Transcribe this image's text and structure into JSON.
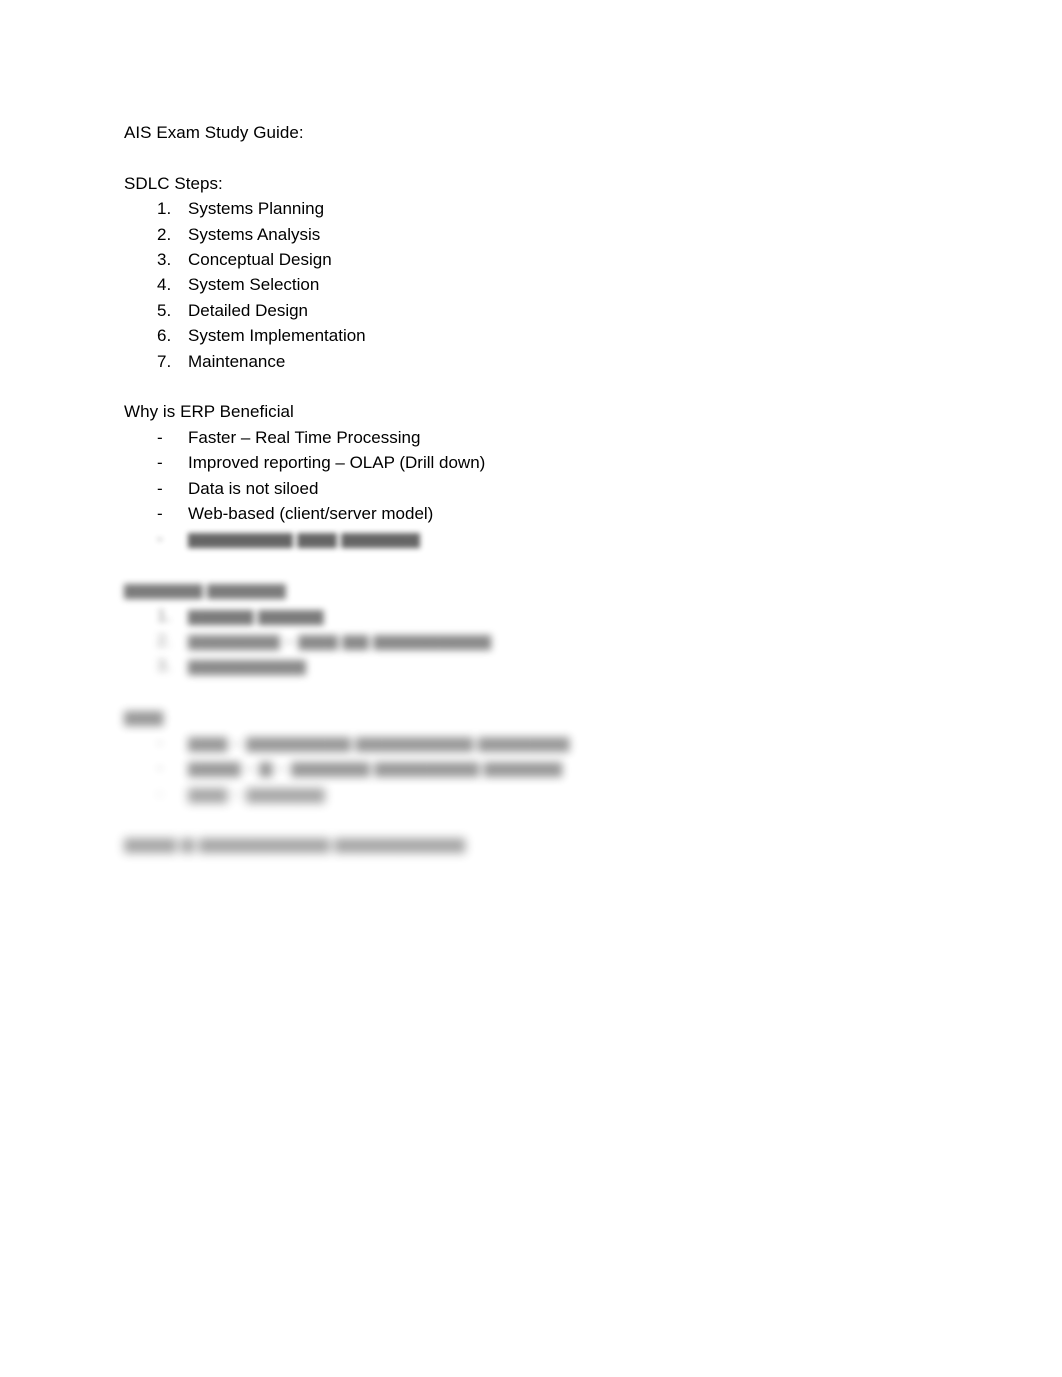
{
  "document": {
    "title": "AIS Exam Study Guide:",
    "page_background": "#ffffff",
    "text_color": "#000000",
    "sections": {
      "sdlc": {
        "heading": "SDLC Steps:",
        "list_type": "numbered",
        "items": [
          {
            "marker": "1.",
            "text": "Systems Planning"
          },
          {
            "marker": "2.",
            "text": "Systems Analysis"
          },
          {
            "marker": "3.",
            "text": "Conceptual Design"
          },
          {
            "marker": "4.",
            "text": "System Selection"
          },
          {
            "marker": "5.",
            "text": "Detailed Design"
          },
          {
            "marker": "6.",
            "text": "System Implementation"
          },
          {
            "marker": "7.",
            "text": "Maintenance"
          }
        ]
      },
      "erp": {
        "heading": "Why is ERP Beneficial",
        "list_type": "dash",
        "items": [
          {
            "marker": "-",
            "text": "Faster – Real Time Processing"
          },
          {
            "marker": "-",
            "text": "Improved reporting – OLAP (Drill down)"
          },
          {
            "marker": "-",
            "text": "Data is not siloed"
          },
          {
            "marker": "-",
            "text": "Web-based (client/server model)"
          }
        ]
      }
    },
    "redacted": {
      "note": "Lower portion of the page is blurred and illegible.",
      "blocks": [
        {
          "kind": "trailing-list-item",
          "lines": [
            {
              "marker": "-",
              "placeholder": "▆▆▆▆▆▆▆▆ ▆▆▆ ▆▆▆▆▆▆",
              "blur": "blur-1"
            }
          ]
        },
        {
          "kind": "heading-with-numbered-list",
          "heading": {
            "placeholder": "▆▆▆▆▆▆ ▆▆▆▆▆▆",
            "blur": "blur-2"
          },
          "lines": [
            {
              "marker": "1.",
              "placeholder": "▆▆▆▆▆ ▆▆▆▆▆",
              "blur": "blur-2"
            },
            {
              "marker": "2.",
              "placeholder": "▆▆▆▆▆▆▆ – ▆▆▆ ▆▆ ▆▆▆▆▆▆▆▆▆",
              "blur": "blur-3"
            },
            {
              "marker": "3.",
              "placeholder": "▆▆▆▆▆▆▆▆▆",
              "blur": "blur-3"
            }
          ]
        },
        {
          "kind": "heading-with-dash-list",
          "heading": {
            "placeholder": "▆▆▆",
            "blur": "blur-4"
          },
          "lines": [
            {
              "marker": "-",
              "placeholder": "▆▆▆ – ▆▆▆▆▆▆▆▆ ▆▆▆▆▆▆▆▆▆ ▆▆▆▆▆▆▆",
              "blur": "blur-4"
            },
            {
              "marker": "-",
              "placeholder": "▆▆▆▆ – ▆ – ▆▆▆▆▆▆ ▆▆▆▆▆▆▆▆ ▆▆▆▆▆▆",
              "blur": "blur-4"
            },
            {
              "marker": "-",
              "placeholder": "▆▆▆ – ▆▆▆▆▆▆",
              "blur": "blur-5"
            }
          ]
        },
        {
          "kind": "standalone-line",
          "lines": [
            {
              "marker": "",
              "placeholder": "▆▆▆▆ ▆ ▆▆▆▆▆▆▆▆▆▆ ▆▆▆▆▆▆▆▆▆▆",
              "blur": "blur-5"
            }
          ]
        }
      ]
    }
  }
}
